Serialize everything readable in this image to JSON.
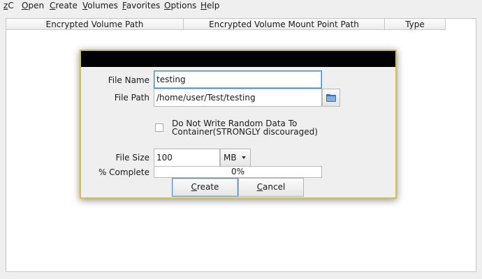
{
  "menubar": {
    "items": [
      {
        "label": "zC"
      },
      {
        "label": "Open"
      },
      {
        "label": "Create"
      },
      {
        "label": "Volumes"
      },
      {
        "label": "Favorites"
      },
      {
        "label": "Options"
      },
      {
        "label": "Help"
      }
    ]
  },
  "table": {
    "columns": [
      "Encrypted Volume Path",
      "Encrypted Volume Mount Point Path",
      "Type"
    ]
  },
  "dialog": {
    "title": "",
    "file_name_label": "File Name",
    "file_name_value": "testing",
    "file_path_label": "File Path",
    "file_path_value": "/home/user/Test/testing",
    "folder_icon": "folder-open-icon",
    "checkbox_label_line1": "Do Not Write Random Data To",
    "checkbox_label_line2": "Container(STRONGLY discouraged)",
    "checkbox_checked": false,
    "file_size_label": "File Size",
    "file_size_value": "100",
    "size_unit": "MB",
    "percent_label": "% Complete",
    "progress_text": "0%",
    "progress_fraction": 0,
    "create_label": "Create",
    "cancel_label": "Cancel"
  },
  "colors": {
    "dialog_border": "#d3c24a",
    "focus": "#4a8bc2",
    "title_bar": "#020202"
  }
}
